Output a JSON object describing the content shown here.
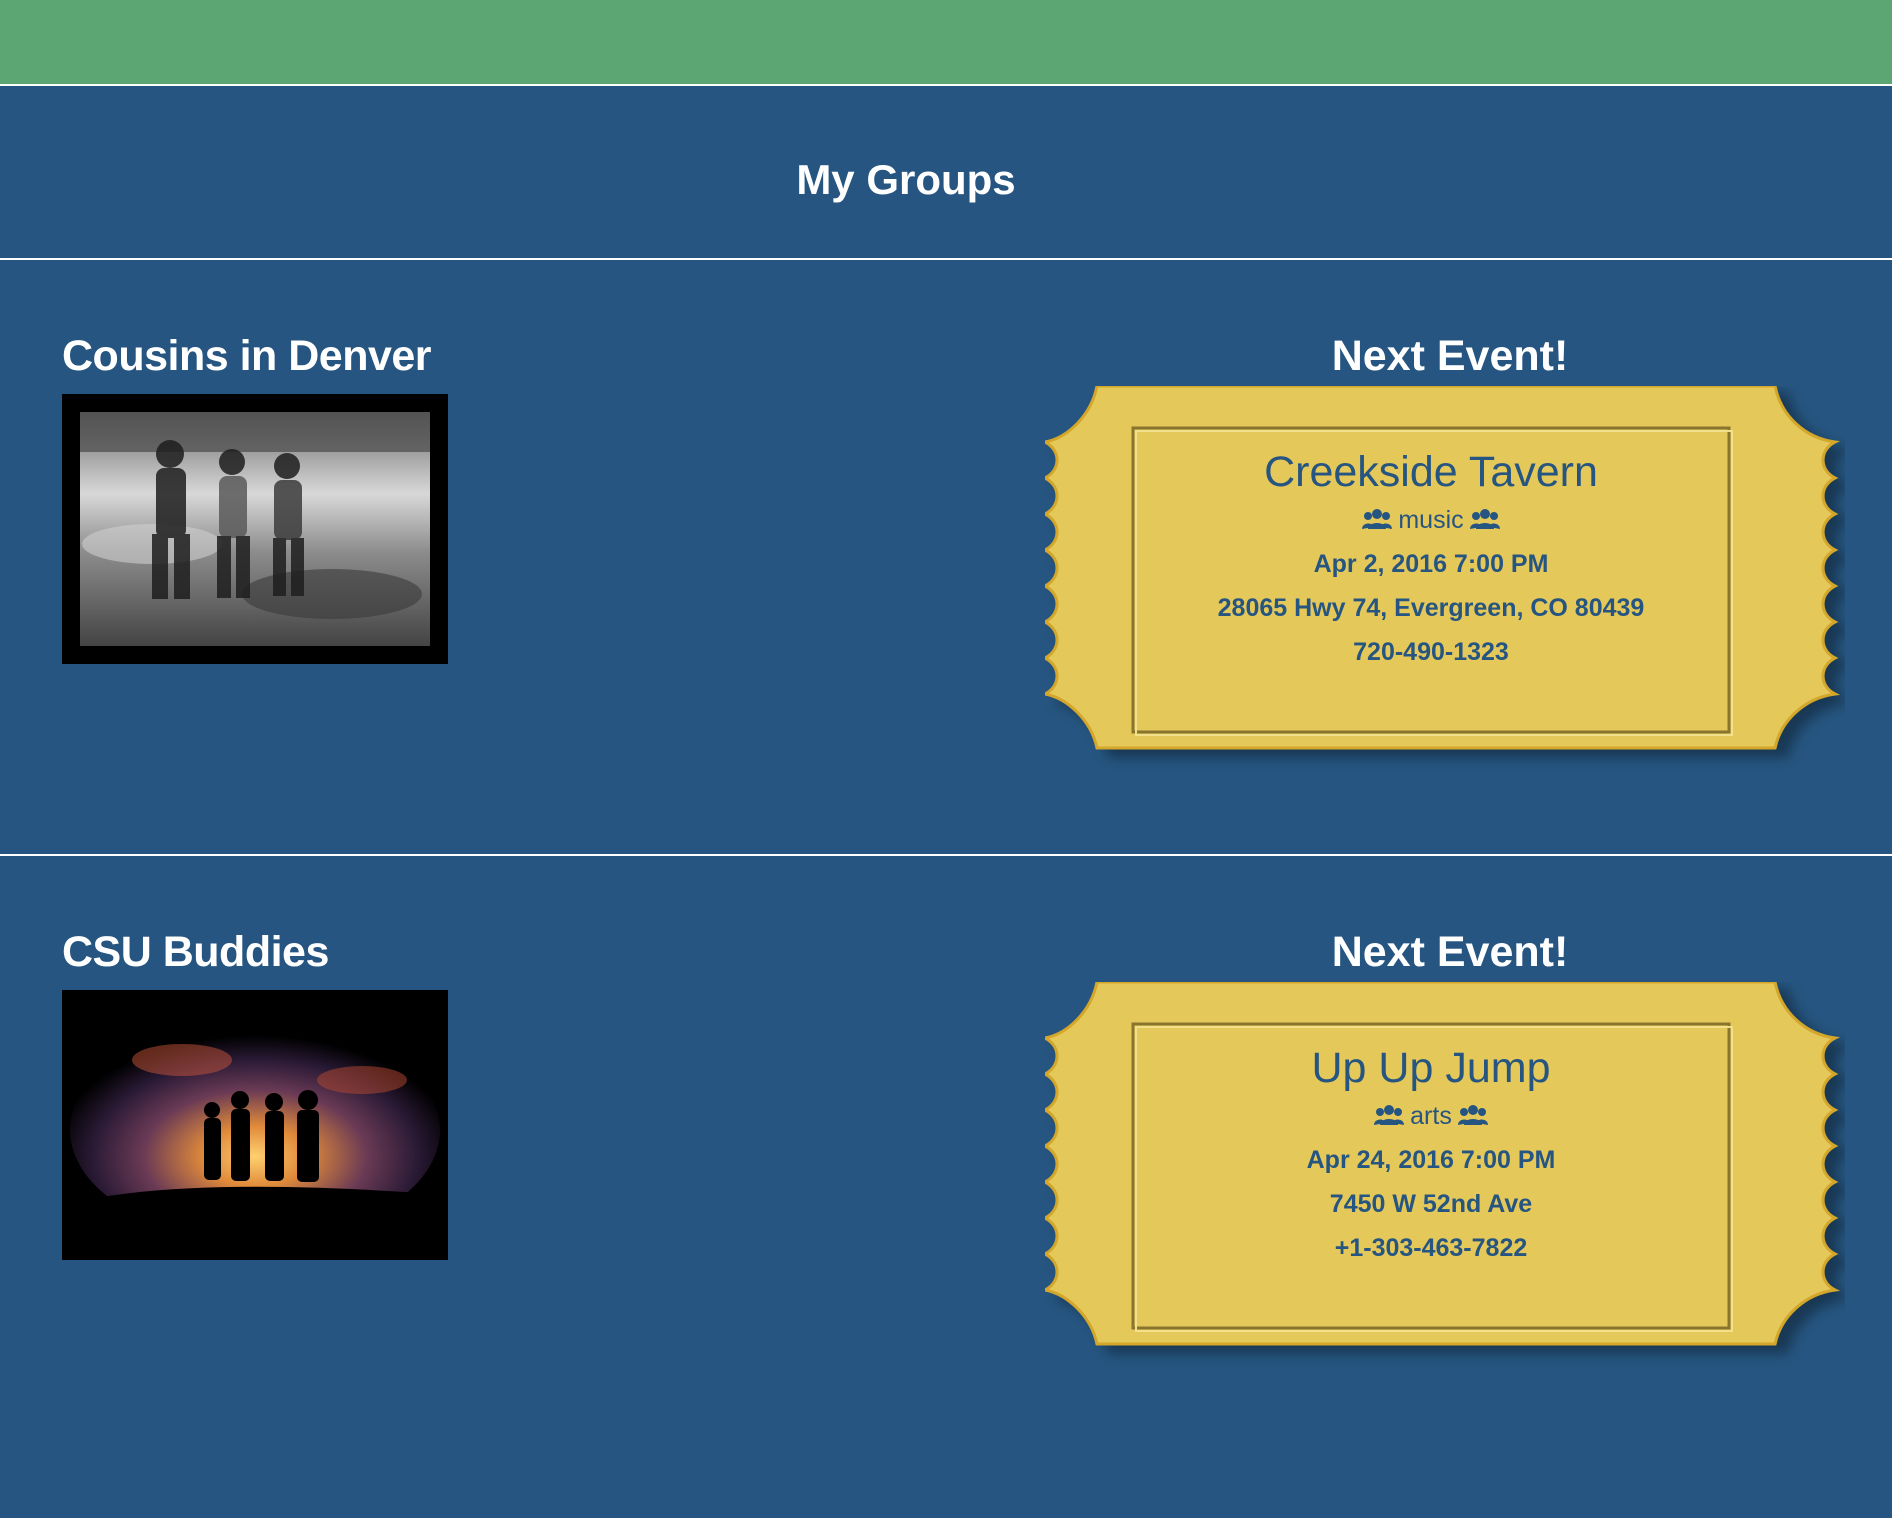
{
  "page": {
    "title": "My Groups"
  },
  "colors": {
    "header_bar": "#5ba673",
    "background": "#255580",
    "ticket_gold": "#e5c85a",
    "ticket_edge": "#d4a62a",
    "text_on_ticket": "#255580"
  },
  "groups": [
    {
      "name": "Cousins in Denver",
      "photo": "black-and-white photo of three girls walking through a creek",
      "next_event_label": "Next Event!",
      "event": {
        "name": "Creekside Tavern",
        "category": "music",
        "category_icon": "users-icon",
        "datetime": "Apr 2, 2016 7:00 PM",
        "address": "28065 Hwy 74, Evergreen, CO 80439",
        "phone": "720-490-1323"
      }
    },
    {
      "name": "CSU Buddies",
      "photo": "silhouettes of four people against a sunset sky",
      "next_event_label": "Next Event!",
      "event": {
        "name": "Up Up Jump",
        "category": "arts",
        "category_icon": "users-icon",
        "datetime": "Apr 24, 2016 7:00 PM",
        "address": "7450 W 52nd Ave",
        "phone": "+1-303-463-7822"
      }
    }
  ]
}
